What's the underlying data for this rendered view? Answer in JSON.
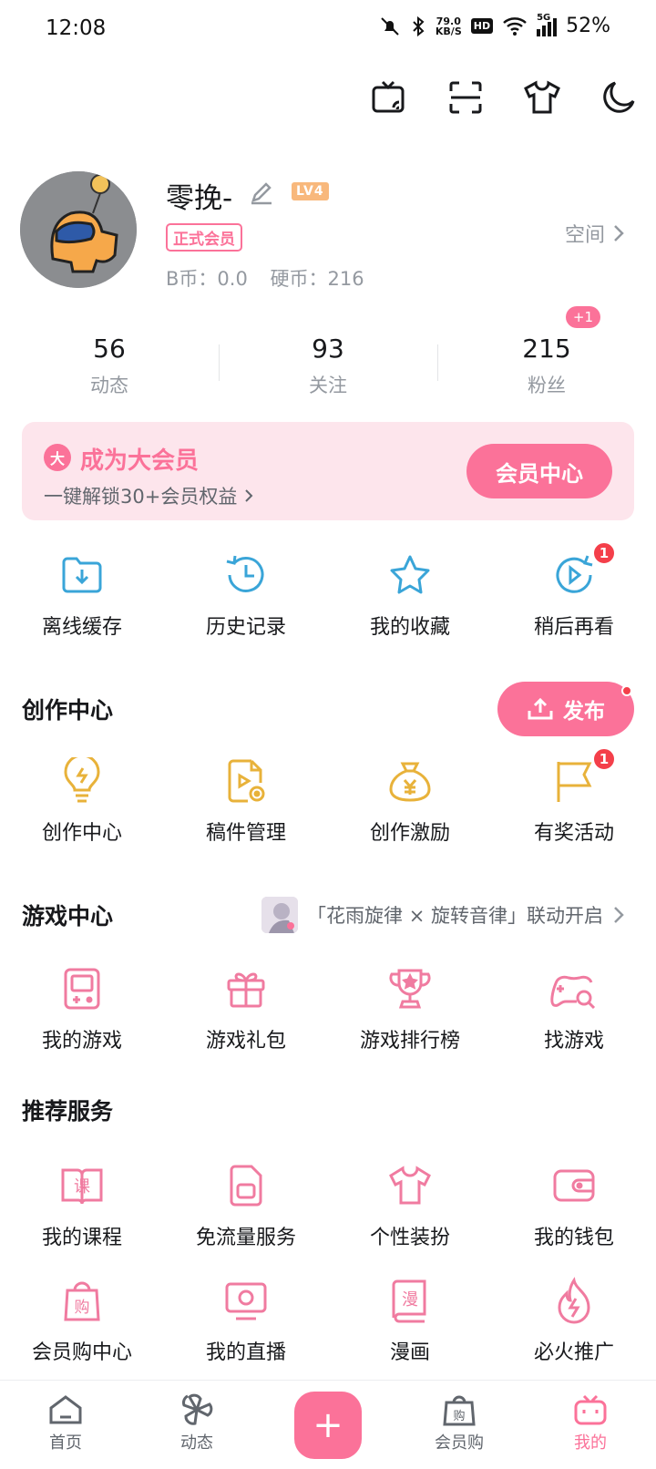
{
  "status_bar": {
    "time": "12:08",
    "net_speed_value": "79.0",
    "net_speed_unit": "KB/S",
    "hd": "HD",
    "network": "5G",
    "battery": "52%"
  },
  "profile": {
    "username": "零挽-",
    "level": "LV4",
    "vip_badge": "正式会员",
    "b_coin_label": "B币：",
    "b_coin": "0.0",
    "coin_label": "硬币：",
    "coin": "216",
    "space_link": "空间"
  },
  "stats": [
    {
      "value": "56",
      "label": "动态"
    },
    {
      "value": "93",
      "label": "关注"
    },
    {
      "value": "215",
      "label": "粉丝",
      "badge": "+1"
    }
  ],
  "vip_card": {
    "icon_text": "大",
    "title": "成为大会员",
    "subtitle": "一键解锁30+会员权益",
    "button": "会员中心"
  },
  "quick_actions": [
    {
      "label": "离线缓存"
    },
    {
      "label": "历史记录"
    },
    {
      "label": "我的收藏"
    },
    {
      "label": "稍后再看",
      "badge": "1"
    }
  ],
  "creation": {
    "title": "创作中心",
    "publish": "发布",
    "items": [
      {
        "label": "创作中心"
      },
      {
        "label": "稿件管理"
      },
      {
        "label": "创作激励"
      },
      {
        "label": "有奖活动",
        "badge": "1"
      }
    ]
  },
  "games": {
    "title": "游戏中心",
    "banner": "「花雨旋律 × 旋转音律」联动开启",
    "items": [
      {
        "label": "我的游戏"
      },
      {
        "label": "游戏礼包"
      },
      {
        "label": "游戏排行榜"
      },
      {
        "label": "找游戏"
      }
    ]
  },
  "services": {
    "title": "推荐服务",
    "row1": [
      {
        "label": "我的课程",
        "glyph": "课"
      },
      {
        "label": "免流量服务"
      },
      {
        "label": "个性装扮"
      },
      {
        "label": "我的钱包"
      }
    ],
    "row2": [
      {
        "label": "会员购中心",
        "glyph": "购"
      },
      {
        "label": "我的直播"
      },
      {
        "label": "漫画",
        "glyph": "漫"
      },
      {
        "label": "必火推广"
      }
    ]
  },
  "tabbar": [
    {
      "label": "首页"
    },
    {
      "label": "动态"
    },
    {
      "label": "+"
    },
    {
      "label": "会员购",
      "glyph": "购"
    },
    {
      "label": "我的"
    }
  ],
  "colors": {
    "accent": "#fb7299",
    "blue_icon": "#3aa5d8",
    "gold_icon": "#e8b23a",
    "badge_red": "#f43f4a"
  }
}
